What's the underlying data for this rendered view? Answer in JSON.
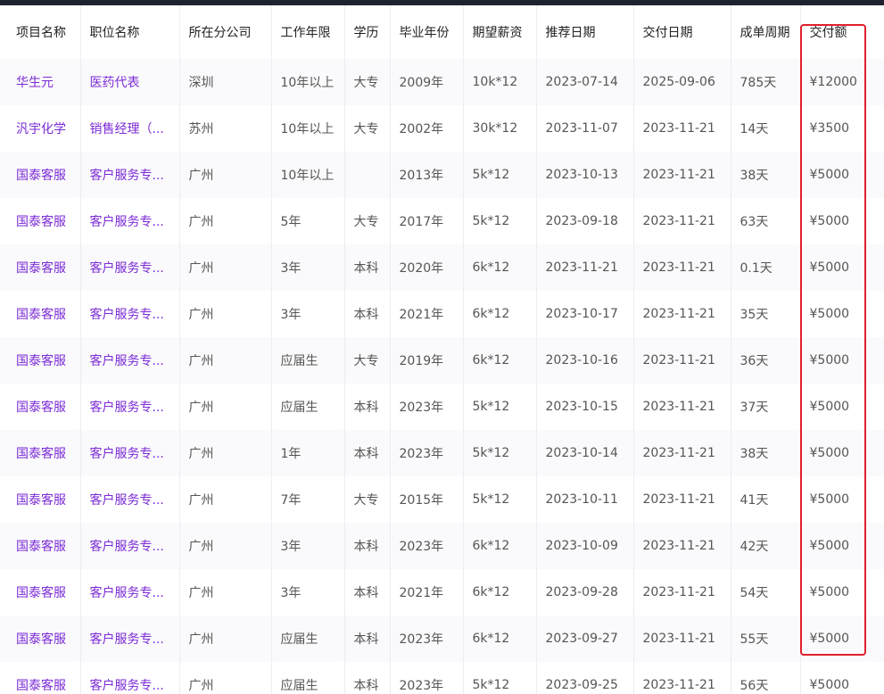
{
  "table": {
    "columns": [
      "项目名称",
      "职位名称",
      "所在分公司",
      "工作年限",
      "学历",
      "毕业年份",
      "期望薪资",
      "推荐日期",
      "交付日期",
      "成单周期",
      "交付额"
    ],
    "rows": [
      [
        "华生元",
        "医药代表",
        "深圳",
        "10年以上",
        "大专",
        "2009年",
        "10k*12",
        "2023-07-14",
        "2025-09-06",
        "785天",
        "¥12000"
      ],
      [
        "汎宇化学",
        "销售经理（...",
        "苏州",
        "10年以上",
        "大专",
        "2002年",
        "30k*12",
        "2023-11-07",
        "2023-11-21",
        "14天",
        "¥3500"
      ],
      [
        "国泰客服",
        "客户服务专...",
        "广州",
        "10年以上",
        "",
        "2013年",
        "5k*12",
        "2023-10-13",
        "2023-11-21",
        "38天",
        "¥5000"
      ],
      [
        "国泰客服",
        "客户服务专...",
        "广州",
        "5年",
        "大专",
        "2017年",
        "5k*12",
        "2023-09-18",
        "2023-11-21",
        "63天",
        "¥5000"
      ],
      [
        "国泰客服",
        "客户服务专...",
        "广州",
        "3年",
        "本科",
        "2020年",
        "6k*12",
        "2023-11-21",
        "2023-11-21",
        "0.1天",
        "¥5000"
      ],
      [
        "国泰客服",
        "客户服务专...",
        "广州",
        "3年",
        "本科",
        "2021年",
        "6k*12",
        "2023-10-17",
        "2023-11-21",
        "35天",
        "¥5000"
      ],
      [
        "国泰客服",
        "客户服务专...",
        "广州",
        "应届生",
        "大专",
        "2019年",
        "6k*12",
        "2023-10-16",
        "2023-11-21",
        "36天",
        "¥5000"
      ],
      [
        "国泰客服",
        "客户服务专...",
        "广州",
        "应届生",
        "本科",
        "2023年",
        "5k*12",
        "2023-10-15",
        "2023-11-21",
        "37天",
        "¥5000"
      ],
      [
        "国泰客服",
        "客户服务专...",
        "广州",
        "1年",
        "本科",
        "2023年",
        "5k*12",
        "2023-10-14",
        "2023-11-21",
        "38天",
        "¥5000"
      ],
      [
        "国泰客服",
        "客户服务专...",
        "广州",
        "7年",
        "大专",
        "2015年",
        "5k*12",
        "2023-10-11",
        "2023-11-21",
        "41天",
        "¥5000"
      ],
      [
        "国泰客服",
        "客户服务专...",
        "广州",
        "3年",
        "本科",
        "2023年",
        "6k*12",
        "2023-10-09",
        "2023-11-21",
        "42天",
        "¥5000"
      ],
      [
        "国泰客服",
        "客户服务专...",
        "广州",
        "3年",
        "本科",
        "2021年",
        "6k*12",
        "2023-09-28",
        "2023-11-21",
        "54天",
        "¥5000"
      ],
      [
        "国泰客服",
        "客户服务专...",
        "广州",
        "应届生",
        "本科",
        "2023年",
        "6k*12",
        "2023-09-27",
        "2023-11-21",
        "55天",
        "¥5000"
      ],
      [
        "国泰客服",
        "客户服务专...",
        "广州",
        "应届生",
        "本科",
        "2023年",
        "5k*12",
        "2023-09-25",
        "2023-11-21",
        "56天",
        "¥5000"
      ]
    ]
  },
  "colors": {
    "link": "#7b2bd6",
    "highlight": "#e0202b"
  }
}
